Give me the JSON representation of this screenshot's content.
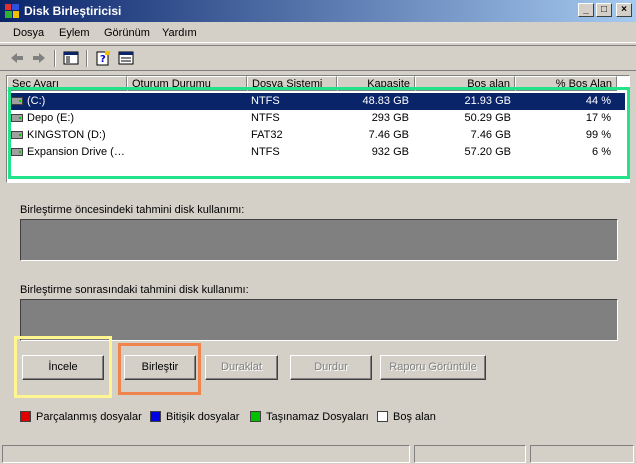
{
  "window": {
    "title": "Disk Birleştiricisi"
  },
  "menu": [
    "Dosya",
    "Eylem",
    "Görünüm",
    "Yardım"
  ],
  "columns": [
    "Seç Ayarı",
    "Oturum Durumu",
    "Dosya Sistemi",
    "Kapasite",
    "Boş alan",
    "% Boş Alan"
  ],
  "volumes": [
    {
      "name": "(C:)",
      "session": "",
      "fs": "NTFS",
      "capacity": "48.83 GB",
      "free": "21.93 GB",
      "pct": "44 %",
      "selected": true
    },
    {
      "name": "Depo (E:)",
      "session": "",
      "fs": "NTFS",
      "capacity": "293 GB",
      "free": "50.29 GB",
      "pct": "17 %"
    },
    {
      "name": "KINGSTON (D:)",
      "session": "",
      "fs": "FAT32",
      "capacity": "7.46 GB",
      "free": "7.46 GB",
      "pct": "99 %"
    },
    {
      "name": "Expansion Drive (…",
      "session": "",
      "fs": "NTFS",
      "capacity": "932 GB",
      "free": "57.20 GB",
      "pct": "6 %"
    }
  ],
  "labels": {
    "before": "Birleştirme öncesindeki tahmini disk kullanımı:",
    "after": "Birleştirme sonrasındaki tahmini disk kullanımı:"
  },
  "buttons": {
    "analyze": "İncele",
    "defrag": "Birleştir",
    "pause": "Duraklat",
    "stop": "Durdur",
    "report": "Raporu Görüntüle"
  },
  "legend": [
    {
      "label": "Parçalanmış dosyalar",
      "color": "#e00000"
    },
    {
      "label": "Bitişik dosyalar",
      "color": "#0000e0"
    },
    {
      "label": "Taşınamaz Dosyaları",
      "color": "#00c000"
    },
    {
      "label": "Boş alan",
      "color": "#ffffff"
    }
  ],
  "highlight_colors": {
    "list": "#22e38a",
    "analyze": "#fff68f",
    "defrag": "#f0844d"
  }
}
